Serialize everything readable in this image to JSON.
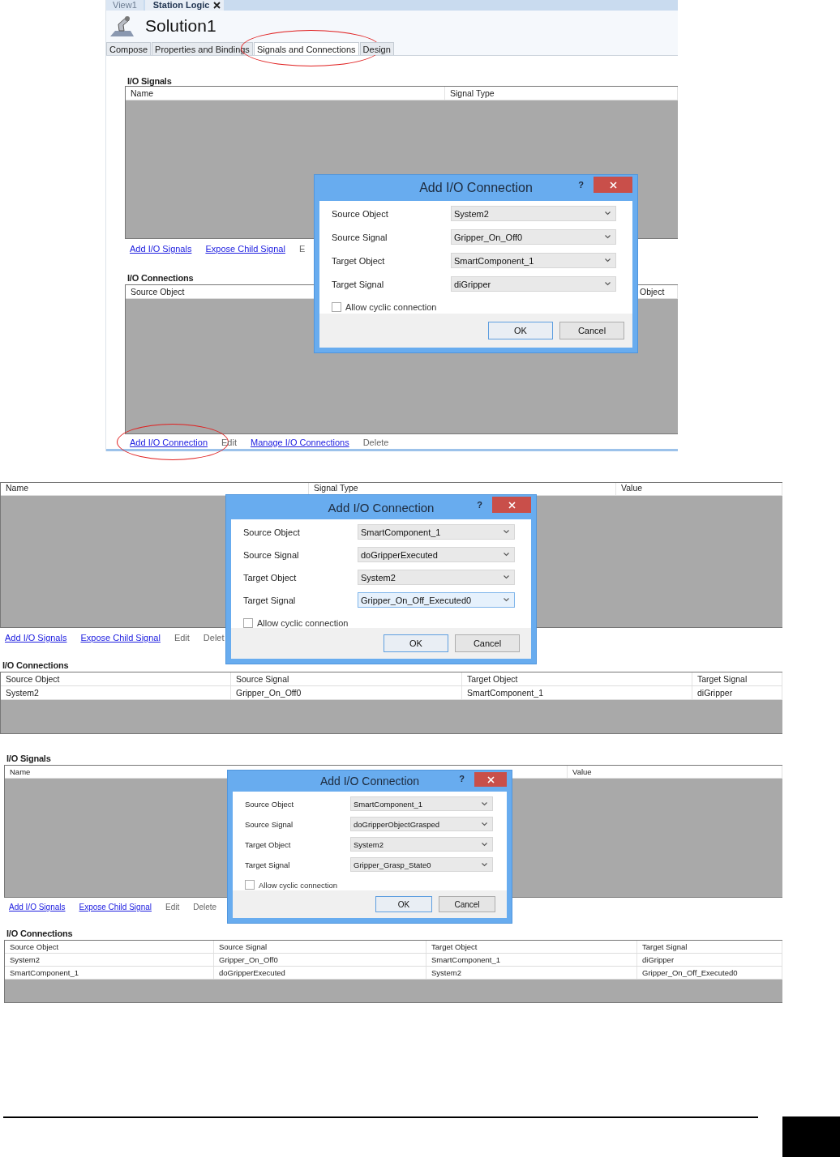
{
  "panels": [
    {
      "document_tabs": [
        {
          "label": "View1",
          "selected": false,
          "closable": false
        },
        {
          "label": "Station Logic",
          "selected": true,
          "closable": true
        }
      ],
      "title": "Solution1",
      "tabs": [
        {
          "label": "Compose",
          "selected": false,
          "annotated": false
        },
        {
          "label": "Properties and Bindings",
          "selected": false,
          "annotated": false
        },
        {
          "label": "Signals and Connections",
          "selected": true,
          "annotated": true
        },
        {
          "label": "Design",
          "selected": false,
          "annotated": false
        }
      ],
      "signals": {
        "heading": "I/O Signals",
        "columns": [
          "Name",
          "Signal Type"
        ],
        "links": [
          {
            "label": "Add I/O Signals",
            "enabled": true,
            "annotated": false
          },
          {
            "label": "Expose Child Signal",
            "enabled": true,
            "annotated": false
          },
          {
            "label": "E",
            "enabled": false,
            "annotated": false
          }
        ]
      },
      "connections": {
        "heading": "I/O Connections",
        "columns": [
          "Source Object",
          "Object"
        ],
        "links": [
          {
            "label": "Add I/O Connection",
            "enabled": true,
            "annotated": true
          },
          {
            "label": "Edit",
            "enabled": false,
            "annotated": false
          },
          {
            "label": "Manage I/O Connections",
            "enabled": true,
            "annotated": false
          },
          {
            "label": "Delete",
            "enabled": false,
            "annotated": false
          }
        ]
      },
      "dialog": {
        "title": "Add I/O Connection",
        "help": "?",
        "fields": [
          {
            "label": "Source Object",
            "value": "System2",
            "focused": false
          },
          {
            "label": "Source Signal",
            "value": "Gripper_On_Off0",
            "focused": false
          },
          {
            "label": "Target Object",
            "value": "SmartComponent_1",
            "focused": false
          },
          {
            "label": "Target Signal",
            "value": "diGripper",
            "focused": false
          }
        ],
        "checkbox": {
          "label": "Allow cyclic connection",
          "checked": false
        },
        "buttons": [
          {
            "label": "OK",
            "default": true
          },
          {
            "label": "Cancel",
            "default": false
          }
        ]
      }
    },
    {
      "signals": {
        "columns": [
          "Name",
          "Signal Type",
          "Value"
        ],
        "links": [
          {
            "label": "Add I/O Signals",
            "enabled": true,
            "annotated": false
          },
          {
            "label": "Expose Child Signal",
            "enabled": true,
            "annotated": false
          },
          {
            "label": "Edit",
            "enabled": false,
            "annotated": false
          },
          {
            "label": "Delet",
            "enabled": false,
            "annotated": false
          }
        ]
      },
      "connections": {
        "heading": "I/O Connections",
        "columns": [
          "Source Object",
          "Source Signal",
          "Target Object",
          "Target Signal"
        ],
        "rows": [
          [
            "System2",
            "Gripper_On_Off0",
            "SmartComponent_1",
            "diGripper"
          ]
        ]
      },
      "dialog": {
        "title": "Add I/O Connection",
        "help": "?",
        "fields": [
          {
            "label": "Source Object",
            "value": "SmartComponent_1",
            "focused": false
          },
          {
            "label": "Source Signal",
            "value": "doGripperExecuted",
            "focused": false
          },
          {
            "label": "Target Object",
            "value": "System2",
            "focused": false
          },
          {
            "label": "Target Signal",
            "value": "Gripper_On_Off_Executed0",
            "focused": true
          }
        ],
        "checkbox": {
          "label": "Allow cyclic connection",
          "checked": false
        },
        "buttons": [
          {
            "label": "OK",
            "default": true
          },
          {
            "label": "Cancel",
            "default": false
          }
        ]
      }
    },
    {
      "signals": {
        "heading": "I/O Signals",
        "columns": [
          "Name",
          "Value"
        ],
        "links": [
          {
            "label": "Add I/O Signals",
            "enabled": true,
            "annotated": false
          },
          {
            "label": "Expose Child Signal",
            "enabled": true,
            "annotated": false
          },
          {
            "label": "Edit",
            "enabled": false,
            "annotated": false
          },
          {
            "label": "Delete",
            "enabled": false,
            "annotated": false
          }
        ]
      },
      "connections": {
        "heading": "I/O Connections",
        "columns": [
          "Source Object",
          "Source Signal",
          "Target Object",
          "Target Signal"
        ],
        "rows": [
          [
            "System2",
            "Gripper_On_Off0",
            "SmartComponent_1",
            "diGripper"
          ],
          [
            "SmartComponent_1",
            "doGripperExecuted",
            "System2",
            "Gripper_On_Off_Executed0"
          ]
        ]
      },
      "dialog": {
        "title": "Add I/O Connection",
        "help": "?",
        "fields": [
          {
            "label": "Source Object",
            "value": "SmartComponent_1",
            "focused": false
          },
          {
            "label": "Source Signal",
            "value": "doGripperObjectGrasped",
            "focused": false
          },
          {
            "label": "Target Object",
            "value": "System2",
            "focused": false
          },
          {
            "label": "Target Signal",
            "value": "Gripper_Grasp_State0",
            "focused": false
          }
        ],
        "checkbox": {
          "label": "Allow cyclic connection",
          "checked": false
        },
        "buttons": [
          {
            "label": "OK",
            "default": true
          },
          {
            "label": "Cancel",
            "default": false
          }
        ]
      }
    }
  ]
}
